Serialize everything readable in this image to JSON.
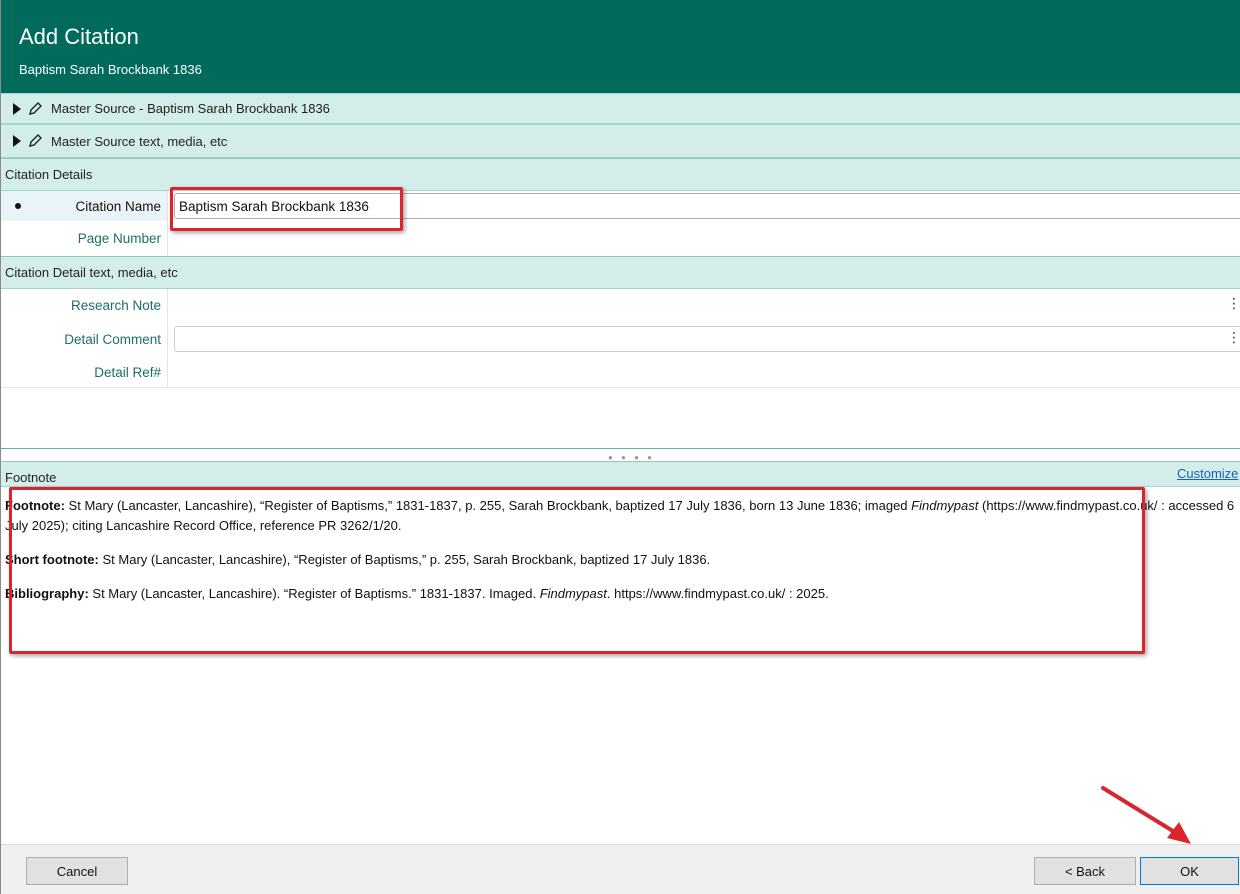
{
  "window": {
    "title": "Add Citation",
    "subtitle": "Baptism Sarah Brockbank 1836"
  },
  "master_sections": [
    {
      "label": "Master Source - Baptism Sarah Brockbank 1836"
    },
    {
      "label": "Master Source text, media, etc"
    }
  ],
  "citation_details": {
    "header": "Citation Details",
    "citation_name_label": "Citation Name",
    "citation_name_value": "Baptism Sarah Brockbank 1836",
    "page_number_label": "Page Number",
    "page_number_value": ""
  },
  "citation_detail_text": {
    "header": "Citation Detail text, media, etc",
    "research_note_label": "Research Note",
    "detail_comment_label": "Detail Comment",
    "detail_ref_label": "Detail Ref#"
  },
  "footnote": {
    "header": "Footnote",
    "customize_label": "Customize",
    "footnote_label": "Footnote:",
    "footnote_text_1": "St Mary (Lancaster, Lancashire), “Register of Baptisms,” 1831-1837, p. 255, Sarah Brockbank, baptized 17 July 1836, born 13 June 1836; imaged",
    "footnote_italic": "Findmypast",
    "footnote_text_2": "(https://www.findmypast.co.uk/ : accessed 6 July 2025); citing Lancashire Record Office, reference PR 3262/1/20.",
    "short_label": "Short footnote:",
    "short_text": "St Mary (Lancaster, Lancashire), “Register of Baptisms,” p. 255, Sarah Brockbank, baptized 17 July 1836.",
    "bib_label": "Bibliography:",
    "bib_text_1": "St Mary (Lancaster, Lancashire). “Register of Baptisms.” 1831-1837. Imaged.",
    "bib_italic": "Findmypast",
    "bib_text_2": ". https://www.findmypast.co.uk/ : 2025."
  },
  "buttons": {
    "cancel": "Cancel",
    "back": "< Back",
    "ok": "OK"
  },
  "icons": {
    "expand": "triangle-right-icon",
    "edit": "pen-icon",
    "ellipsis": "ellipsis-icon"
  },
  "colors": {
    "title_bar": "#006b5a",
    "section_bg": "#d3eeea",
    "label_text": "#1e6f65",
    "highlight_red": "#d9262d",
    "link": "#1a5fb4"
  }
}
